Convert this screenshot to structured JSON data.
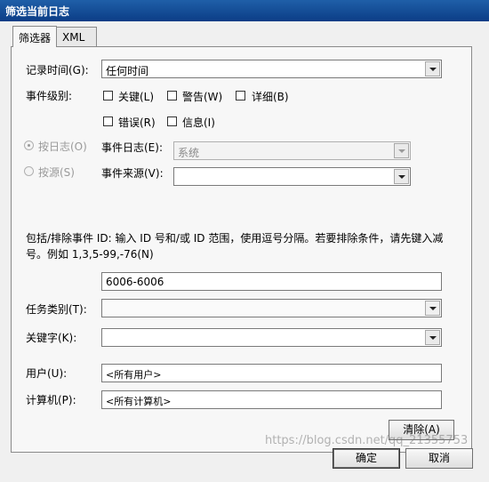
{
  "title": "筛选当前日志",
  "tabs": [
    {
      "label": "筛选器",
      "active": true
    },
    {
      "label": "XML",
      "active": false
    }
  ],
  "fields": {
    "logged_label": "记录时间(G):",
    "logged_value": "任何时间",
    "level_label": "事件级别:",
    "levels": [
      {
        "label": "关键(L)"
      },
      {
        "label": "警告(W)"
      },
      {
        "label": "详细(B)"
      },
      {
        "label": "错误(R)"
      },
      {
        "label": "信息(I)"
      }
    ],
    "by_log_label": "按日志(O)",
    "event_logs_label": "事件日志(E):",
    "event_logs_value": "系统",
    "by_source_label": "按源(S)",
    "event_sources_label": "事件来源(V):",
    "event_sources_value": "",
    "ids_description": "包括/排除事件 ID: 输入 ID 号和/或 ID 范围，使用逗号分隔。若要排除条件，请先键入减号。例如 1,3,5-99,-76(N)",
    "ids_value": "6006-6006",
    "task_label": "任务类别(T):",
    "task_value": "",
    "keywords_label": "关键字(K):",
    "keywords_value": "",
    "user_label": "用户(U):",
    "user_value": "<所有用户>",
    "computer_label": "计算机(P):",
    "computer_value": "<所有计算机>"
  },
  "buttons": {
    "clear": "清除(A)",
    "ok": "确定",
    "cancel": "取消"
  },
  "watermark": "https://blog.csdn.net/qq_21355753"
}
